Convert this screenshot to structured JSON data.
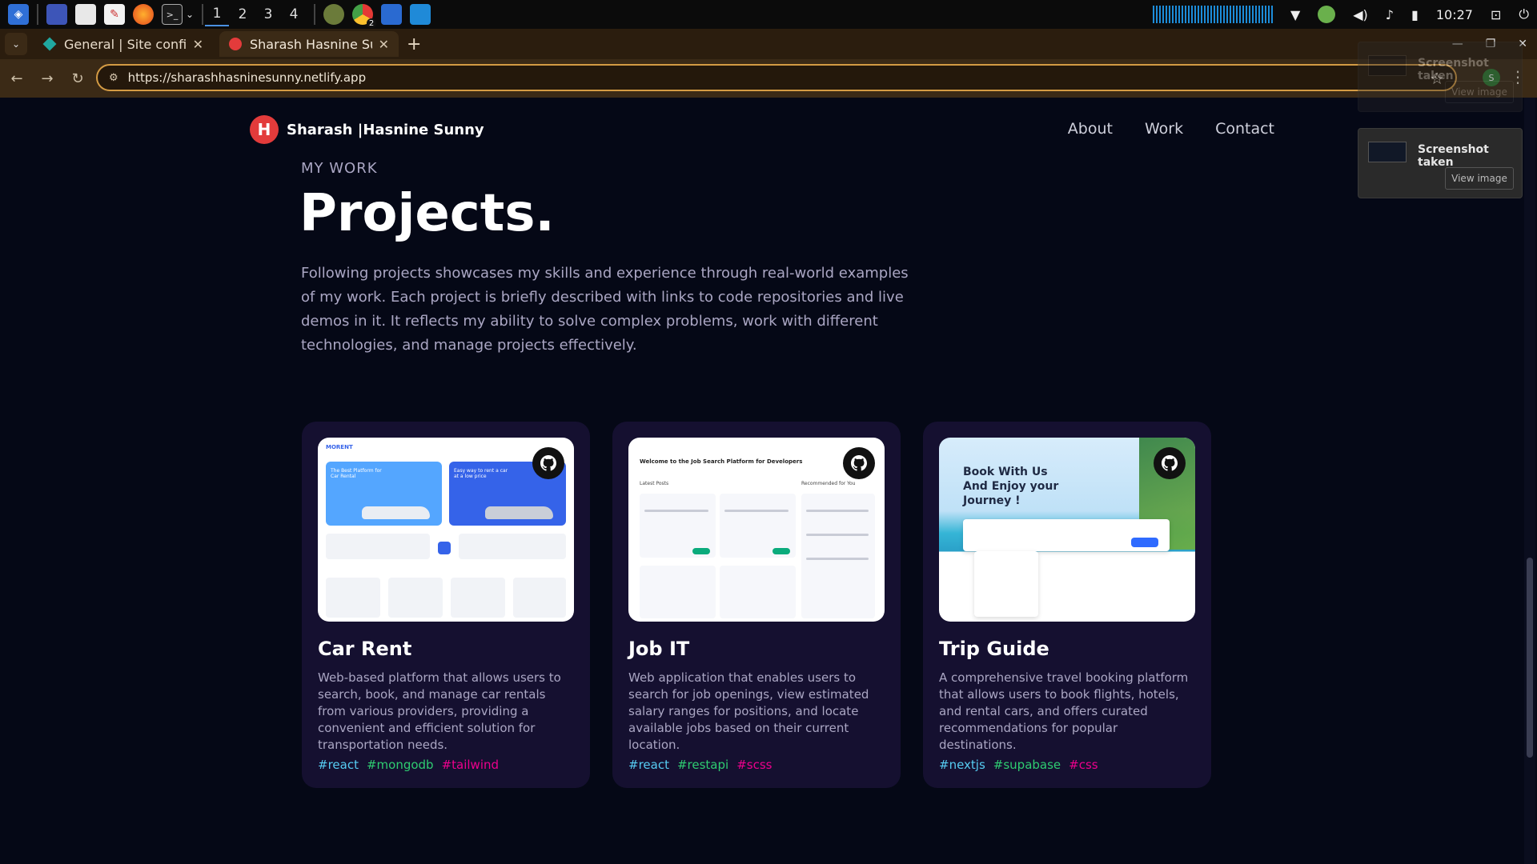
{
  "taskbar": {
    "workspaces": [
      "1",
      "2",
      "3",
      "4"
    ],
    "clock": "10:27",
    "badge_count": "2"
  },
  "browser": {
    "tabs": [
      {
        "title": "General | Site configurati",
        "active": false
      },
      {
        "title": "Sharash Hasnine Sunny",
        "active": true
      }
    ],
    "url": "https://sharashhasninesunny.netlify.app",
    "profile_initial": "S"
  },
  "notifications": [
    {
      "title": "Screenshot taken",
      "button": "View image"
    },
    {
      "title": "Screenshot taken",
      "button": "View image"
    }
  ],
  "site": {
    "logo_letter": "H",
    "brand": "Sharash  |Hasnine Sunny",
    "nav": [
      "About",
      "Work",
      "Contact"
    ]
  },
  "section": {
    "eyebrow": "MY WORK",
    "title": "Projects.",
    "description": "Following projects showcases my skills and experience through real-world examples of my work. Each project is briefly described with links to code repositories and live demos in it. It reflects my ability to solve complex problems, work with different technologies, and manage projects effectively."
  },
  "projects": [
    {
      "name": "Car Rent",
      "description": "Web-based platform that allows users to search, book, and manage car rentals from various providers, providing a convenient and efficient solution for transportation needs.",
      "tags": [
        {
          "name": "#react",
          "color": "#56ccf2"
        },
        {
          "name": "#mongodb",
          "color": "#2ecc71"
        },
        {
          "name": "#tailwind",
          "color": "#ec008c"
        }
      ],
      "thumb_text": {
        "brand": "MORENT",
        "banner1": "The Best Platform for Car Rental",
        "banner2": "Easy way to rent a car at a low price"
      }
    },
    {
      "name": "Job IT",
      "description": "Web application that enables users to search for job openings, view estimated salary ranges for positions, and locate available jobs based on their current location.",
      "tags": [
        {
          "name": "#react",
          "color": "#56ccf2"
        },
        {
          "name": "#restapi",
          "color": "#2ecc71"
        },
        {
          "name": "#scss",
          "color": "#ec008c"
        }
      ],
      "thumb_text": {
        "headline": "Welcome to the Job Search Platform for Developers",
        "left": "Latest Posts",
        "right": "Recommended for You"
      }
    },
    {
      "name": "Trip Guide",
      "description": "A comprehensive travel booking platform that allows users to book flights, hotels, and rental cars, and offers curated recommendations for popular destinations.",
      "tags": [
        {
          "name": "#nextjs",
          "color": "#56ccf2"
        },
        {
          "name": "#supabase",
          "color": "#2ecc71"
        },
        {
          "name": "#css",
          "color": "#ec008c"
        }
      ],
      "thumb_text": {
        "headline": "Book With Us And Enjoy your Journey !"
      }
    }
  ],
  "colors": {
    "page_bg": "#050816",
    "card_bg": "#151030",
    "accent": "#d49b44",
    "secondary_text": "#aaa6c3"
  }
}
